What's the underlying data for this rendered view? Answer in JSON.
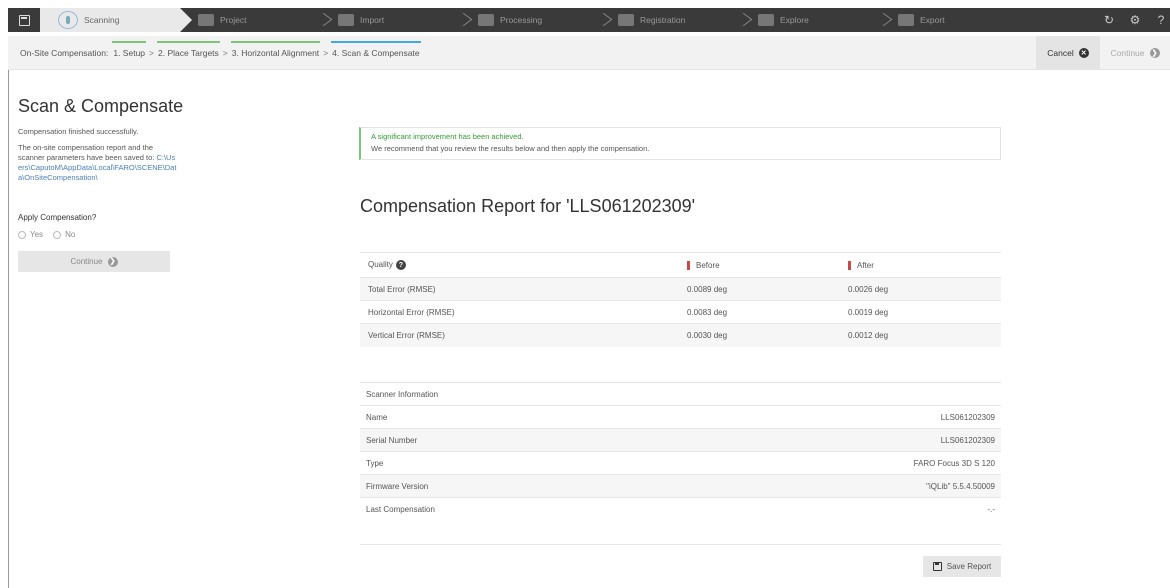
{
  "tabs": [
    {
      "label": "Scanning",
      "active": true,
      "icon": "scanner-icon"
    },
    {
      "label": "Project",
      "icon": "folder-icon"
    },
    {
      "label": "Import",
      "icon": "import-icon"
    },
    {
      "label": "Processing",
      "icon": "filter-icon"
    },
    {
      "label": "Registration",
      "icon": "registration-icon"
    },
    {
      "label": "Explore",
      "icon": "explore-icon"
    },
    {
      "label": "Export",
      "icon": "export-icon"
    }
  ],
  "breadcrumb": {
    "label": "On-Site Compensation:",
    "steps": [
      "1. Setup",
      "2. Place Targets",
      "3. Horizontal Alignment",
      "4. Scan & Compensate"
    ],
    "separator": ">"
  },
  "actions": {
    "cancel": "Cancel",
    "continue": "Continue"
  },
  "left": {
    "title": "Scan & Compensate",
    "status": "Compensation finished successfully.",
    "saved_msg": "The on-site compensation report and the scanner parameters have been saved to:",
    "path": "C:\\Users\\CaputoM\\AppData\\Local\\FARO\\SCENE\\Data\\OnSiteCompensation\\",
    "apply_label": "Apply Compensation?",
    "yes": "Yes",
    "no": "No",
    "continue": "Continue"
  },
  "notice": {
    "headline": "A significant improvement has been achieved.",
    "text": "We recommend that you review the results below and then apply the compensation."
  },
  "report": {
    "title": "Compensation Report for 'LLS061202309'",
    "quality": {
      "headers": [
        "Quality",
        "Before",
        "After"
      ],
      "rows": [
        {
          "label": "Total Error (RMSE)",
          "before": "0.0089 deg",
          "after": "0.0026 deg"
        },
        {
          "label": "Horizontal Error (RMSE)",
          "before": "0.0083 deg",
          "after": "0.0019 deg"
        },
        {
          "label": "Vertical Error (RMSE)",
          "before": "0.0030 deg",
          "after": "0.0012 deg"
        }
      ]
    },
    "scanner": {
      "header": "Scanner Information",
      "rows": [
        {
          "label": "Name",
          "value": "LLS061202309"
        },
        {
          "label": "Serial Number",
          "value": "LLS061202309"
        },
        {
          "label": "Type",
          "value": "FARO Focus 3D S 120"
        },
        {
          "label": "Firmware Version",
          "value": "\"iQLib\" 5.5.4.50009"
        },
        {
          "label": "Last Compensation",
          "value": "-.-"
        }
      ]
    },
    "save": "Save Report"
  }
}
